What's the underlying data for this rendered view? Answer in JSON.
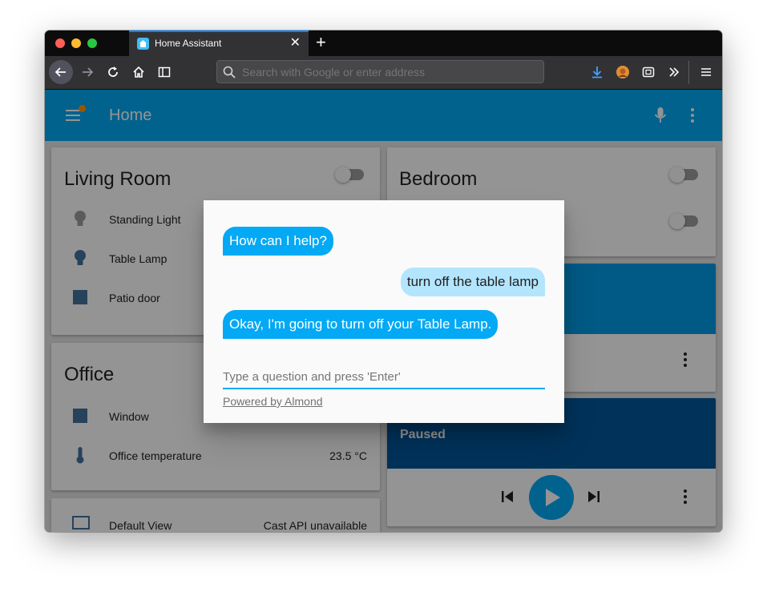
{
  "browser": {
    "tab_title": "Home Assistant",
    "tab_close": "✕",
    "new_tab": "+",
    "url_placeholder": "Search with Google or enter address"
  },
  "header": {
    "title": "Home",
    "accent": "#03a9f4"
  },
  "cards": {
    "living_room": {
      "title": "Living Room",
      "rows": [
        {
          "label": "Standing Light",
          "icon": "lightbulb-icon"
        },
        {
          "label": "Table Lamp",
          "icon": "lightbulb-icon"
        },
        {
          "label": "Patio door",
          "icon": "door-square-icon"
        }
      ]
    },
    "office": {
      "title": "Office",
      "rows": [
        {
          "label": "Window",
          "icon": "window-square-icon"
        },
        {
          "label": "Office temperature",
          "icon": "thermometer-icon",
          "value": "23.5 °C"
        }
      ]
    },
    "default_view": {
      "label": "Default View",
      "value": "Cast API unavailable"
    },
    "bedroom": {
      "title": "Bedroom"
    },
    "media": {
      "status": "Paused"
    }
  },
  "dialog": {
    "messages": [
      {
        "from": "agent",
        "text": "How can I help?"
      },
      {
        "from": "user",
        "text": "turn off the table lamp"
      },
      {
        "from": "agent",
        "text": "Okay, I'm going to turn off your Table Lamp."
      }
    ],
    "input_placeholder": "Type a question and press 'Enter'",
    "powered_by": "Powered by Almond"
  }
}
